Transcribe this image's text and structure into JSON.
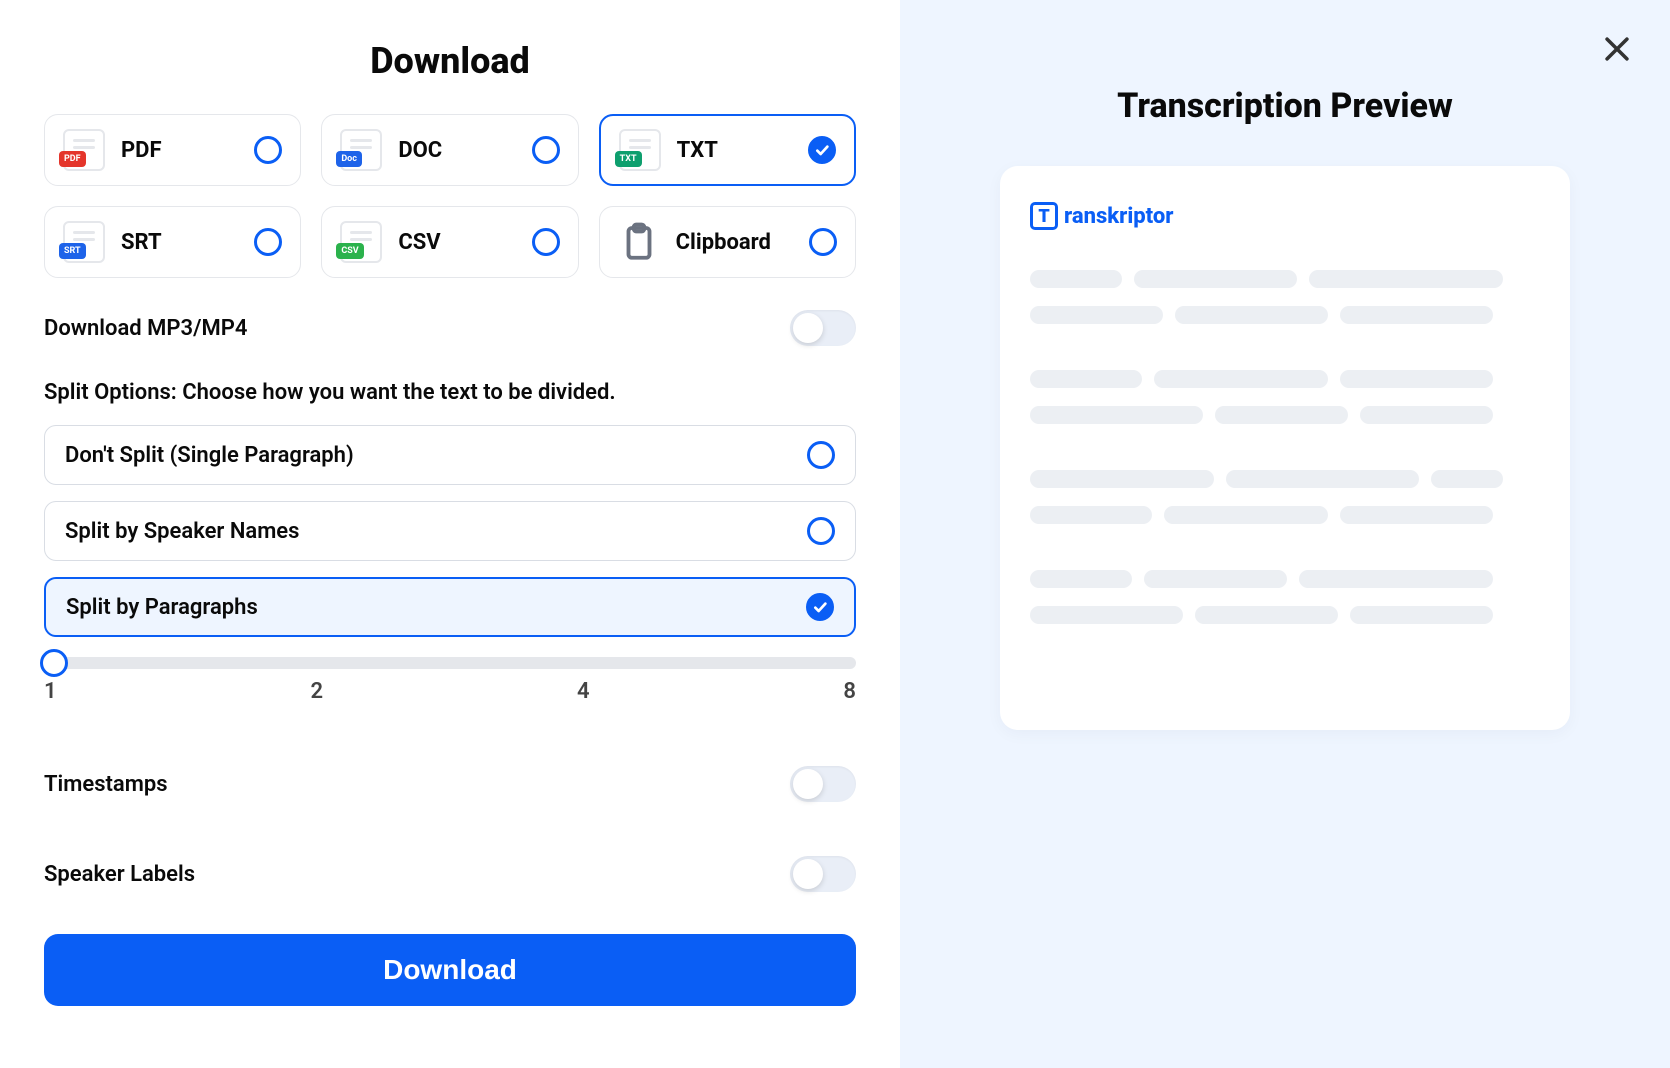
{
  "left": {
    "title": "Download",
    "formats": [
      {
        "id": "pdf",
        "label": "PDF",
        "badge": "PDF",
        "badgeClass": "badge-pdf",
        "selected": false
      },
      {
        "id": "doc",
        "label": "DOC",
        "badge": "Doc",
        "badgeClass": "badge-doc",
        "selected": false
      },
      {
        "id": "txt",
        "label": "TXT",
        "badge": "TXT",
        "badgeClass": "badge-txt",
        "selected": true
      },
      {
        "id": "srt",
        "label": "SRT",
        "badge": "SRT",
        "badgeClass": "badge-srt",
        "selected": false
      },
      {
        "id": "csv",
        "label": "CSV",
        "badge": "CSV",
        "badgeClass": "badge-csv",
        "selected": false
      },
      {
        "id": "clipboard",
        "label": "Clipboard",
        "badge": null,
        "badgeClass": null,
        "selected": false
      }
    ],
    "mp3_label": "Download MP3/MP4",
    "mp3_on": false,
    "split_heading": "Split Options: Choose how you want the text to be divided.",
    "split_options": [
      {
        "label": "Don't Split (Single Paragraph)",
        "selected": false
      },
      {
        "label": "Split by Speaker Names",
        "selected": false
      },
      {
        "label": "Split by Paragraphs",
        "selected": true
      }
    ],
    "slider": {
      "ticks": [
        "1",
        "2",
        "4",
        "8"
      ],
      "value": 1
    },
    "timestamps_label": "Timestamps",
    "timestamps_on": false,
    "speakerlabels_label": "Speaker Labels",
    "speakerlabels_on": false,
    "download_button": "Download"
  },
  "right": {
    "title": "Transcription Preview",
    "brand": "ranskriptor",
    "brand_letter": "T"
  }
}
